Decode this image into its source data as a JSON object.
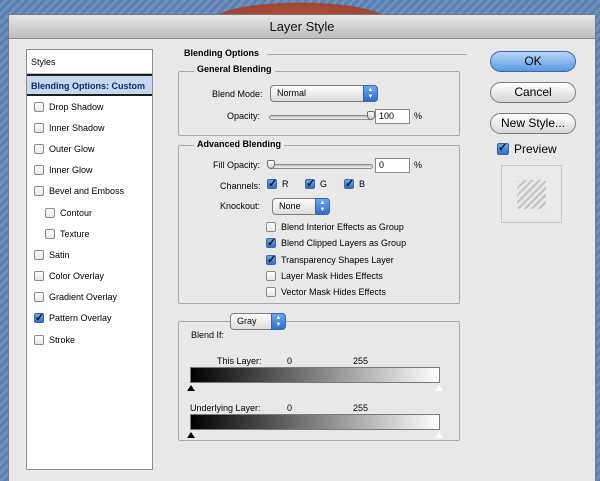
{
  "window": {
    "title": "Layer Style"
  },
  "sidebar": {
    "header": "Styles",
    "selected": "Blending Options: Custom",
    "items": [
      {
        "label": "Drop Shadow",
        "checked": false,
        "indent": false
      },
      {
        "label": "Inner Shadow",
        "checked": false,
        "indent": false
      },
      {
        "label": "Outer Glow",
        "checked": false,
        "indent": false
      },
      {
        "label": "Inner Glow",
        "checked": false,
        "indent": false
      },
      {
        "label": "Bevel and Emboss",
        "checked": false,
        "indent": false
      },
      {
        "label": "Contour",
        "checked": false,
        "indent": true
      },
      {
        "label": "Texture",
        "checked": false,
        "indent": true
      },
      {
        "label": "Satin",
        "checked": false,
        "indent": false
      },
      {
        "label": "Color Overlay",
        "checked": false,
        "indent": false
      },
      {
        "label": "Gradient Overlay",
        "checked": false,
        "indent": false
      },
      {
        "label": "Pattern Overlay",
        "checked": true,
        "indent": false
      },
      {
        "label": "Stroke",
        "checked": false,
        "indent": false
      }
    ]
  },
  "blending_options": {
    "title": "Blending Options",
    "general": {
      "title": "General Blending",
      "blend_mode_label": "Blend Mode:",
      "blend_mode_value": "Normal",
      "opacity_label": "Opacity:",
      "opacity_value": "100",
      "opacity_fraction": 1.0,
      "percent": "%"
    },
    "advanced": {
      "title": "Advanced Blending",
      "fill_opacity_label": "Fill Opacity:",
      "fill_opacity_value": "0",
      "fill_opacity_fraction": 0.0,
      "percent": "%",
      "channels_label": "Channels:",
      "channels": [
        {
          "label": "R",
          "checked": true
        },
        {
          "label": "G",
          "checked": true
        },
        {
          "label": "B",
          "checked": true
        }
      ],
      "knockout_label": "Knockout:",
      "knockout_value": "None",
      "options": [
        {
          "label": "Blend Interior Effects as Group",
          "checked": false
        },
        {
          "label": "Blend Clipped Layers as Group",
          "checked": true
        },
        {
          "label": "Transparency Shapes Layer",
          "checked": true
        },
        {
          "label": "Layer Mask Hides Effects",
          "checked": false
        },
        {
          "label": "Vector Mask Hides Effects",
          "checked": false
        }
      ]
    },
    "blend_if": {
      "label": "Blend If:",
      "value": "Gray",
      "this_layer_label": "This Layer:",
      "this_layer_low": "0",
      "this_layer_high": "255",
      "underlying_label": "Underlying Layer:",
      "underlying_low": "0",
      "underlying_high": "255"
    }
  },
  "buttons": {
    "ok": "OK",
    "cancel": "Cancel",
    "new_style": "New Style...",
    "preview_label": "Preview",
    "preview_checked": true
  }
}
